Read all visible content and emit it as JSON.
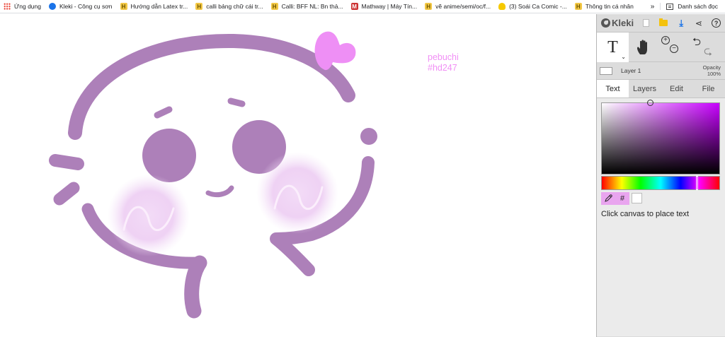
{
  "bookmarks": [
    {
      "label": "Ứng dụng",
      "icon": "apps-grid-icon"
    },
    {
      "label": "Kleki - Công cụ sơn",
      "icon": "kleki-icon"
    },
    {
      "label": "Hướng dẫn Latex tr...",
      "icon": "bookmark-h-icon"
    },
    {
      "label": "calli bảng chữ cái tr...",
      "icon": "bookmark-h-icon"
    },
    {
      "label": "Calli: BFF NL: Bn thả...",
      "icon": "bookmark-h-icon"
    },
    {
      "label": "Mathway | Máy Tín...",
      "icon": "mathway-icon"
    },
    {
      "label": "vẽ anime/semi/oc/f...",
      "icon": "bookmark-h-icon"
    },
    {
      "label": "(3) Soái Ca Comic -...",
      "icon": "bulb-icon"
    },
    {
      "label": "Thông tin cá nhân",
      "icon": "bookmark-h-icon"
    }
  ],
  "bookmarks_more": "»",
  "reading_list": "Danh sách đọc",
  "canvas": {
    "signature_line1": "pebuchi",
    "signature_line2": "#hd247",
    "stroke_color": "#ad80b9",
    "accent_color": "#ee8ff5"
  },
  "panel": {
    "app_name": "Kleki",
    "tool_glyph": "T",
    "tool_caret": "⌄",
    "layer_name": "Layer 1",
    "opacity_label": "Opacity",
    "opacity_value": "100%",
    "tabs": [
      "Text",
      "Layers",
      "Edit",
      "File"
    ],
    "active_tab": "Text",
    "hex_label": "#",
    "hint": "Click canvas to place text",
    "current_color": "#ffffff"
  }
}
